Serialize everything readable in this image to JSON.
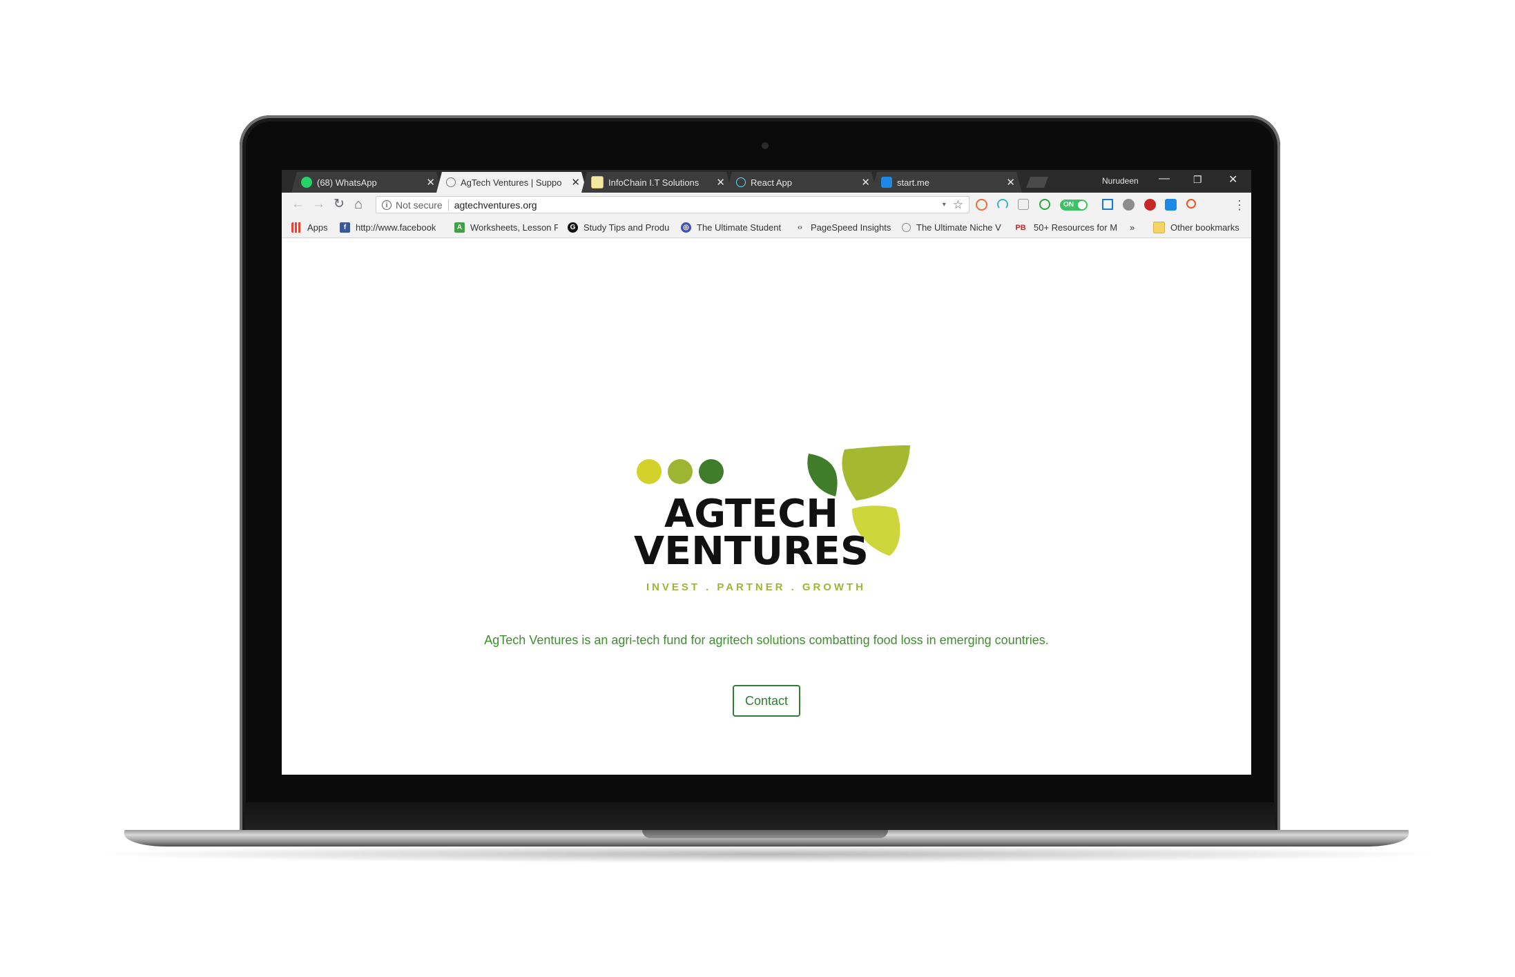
{
  "colors": {
    "brand_dark_green": "#2e7d32",
    "brand_text_green": "#3e8e2e",
    "leaf_dark": "#3f7d2a",
    "leaf_mid": "#a4b92f",
    "leaf_light": "#cdd63a",
    "dot_1": "#d4d22a",
    "dot_2": "#9db532",
    "dot_3": "#3f7d2a"
  },
  "browser": {
    "tabs": [
      {
        "title": "(68) WhatsApp",
        "icon": "whatsapp-icon",
        "active": false,
        "close": "✕"
      },
      {
        "title": "AgTech Ventures | Suppo",
        "icon": "page-icon",
        "active": true,
        "close": "✕"
      },
      {
        "title": "InfoChain I.T Solutions",
        "icon": "doc-icon",
        "active": false,
        "close": "✕"
      },
      {
        "title": "React App",
        "icon": "react-icon",
        "active": false,
        "close": "✕"
      },
      {
        "title": "start.me",
        "icon": "startme-icon",
        "active": false,
        "close": "✕"
      }
    ],
    "profile_name": "Nurudeen",
    "window_controls": {
      "minimize": "—",
      "restore": "❐",
      "close": "✕"
    },
    "nav": {
      "back": "←",
      "forward": "→",
      "reload": "↻",
      "home": "⌂"
    },
    "omnibox": {
      "security_label": "Not secure",
      "url": "agtechventures.org"
    },
    "extensions": {
      "toggle_label": "ON"
    },
    "bookmarks": [
      {
        "label": "Apps",
        "icon": "apps-grid-icon"
      },
      {
        "label": "http://www.facebook",
        "icon": "facebook-icon"
      },
      {
        "label": "Worksheets, Lesson F",
        "icon": "worksheets-icon"
      },
      {
        "label": "Study Tips and Produ",
        "icon": "g-icon"
      },
      {
        "label": "The Ultimate Student",
        "icon": "ultimate-student-icon"
      },
      {
        "label": "PageSpeed Insights",
        "icon": "pagespeed-icon"
      },
      {
        "label": "The Ultimate Niche V",
        "icon": "niche-icon"
      },
      {
        "label": "50+ Resources for M",
        "icon": "pb-icon"
      },
      {
        "label": "»",
        "icon": ""
      },
      {
        "label": "Other bookmarks",
        "icon": "folder-icon"
      }
    ]
  },
  "page": {
    "logo": {
      "line1": "AGTECH",
      "line2": "VENTURES",
      "tagline": "INVEST . PARTNER . GROWTH"
    },
    "description": "AgTech Ventures is an agri-tech fund for agritech solutions combatting food loss in emerging countries.",
    "contact_label": "Contact"
  }
}
